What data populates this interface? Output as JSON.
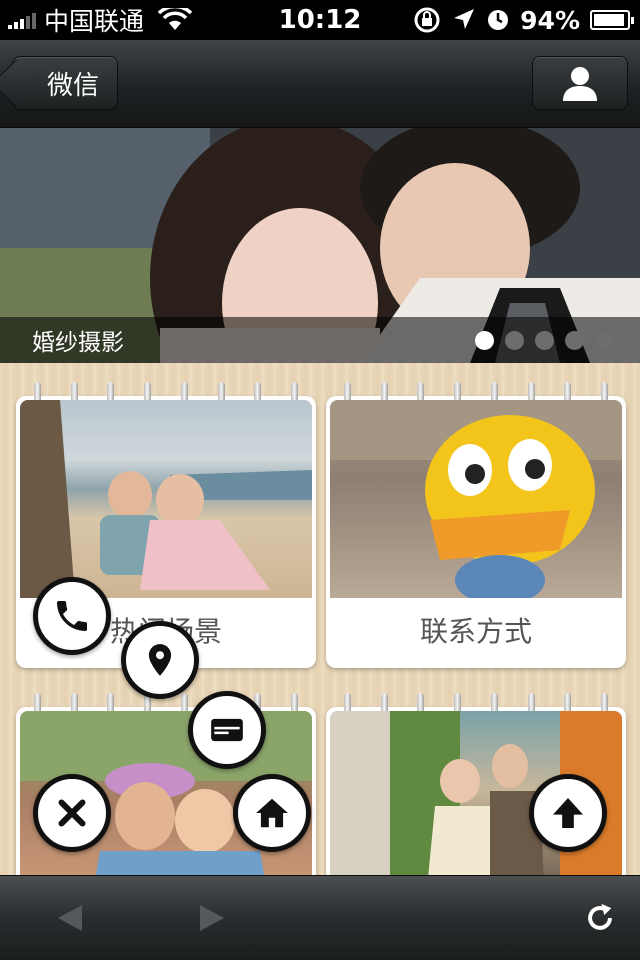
{
  "status_bar": {
    "carrier": "中国联通",
    "time": "10:12",
    "battery_percent_label": "94%",
    "battery_level": 0.94
  },
  "nav": {
    "back_label": "微信",
    "profile_icon": "person-icon"
  },
  "banner": {
    "caption": "婚纱摄影",
    "slide_count": 5,
    "active_slide": 1
  },
  "cards": [
    {
      "label": "热门场景"
    },
    {
      "label": "联系方式"
    },
    {
      "label": ""
    },
    {
      "label": ""
    }
  ],
  "fab_icons": [
    "phone-icon",
    "location-pin-icon",
    "card-icon",
    "close-icon",
    "home-icon",
    "up-arrow-icon"
  ],
  "colors": {
    "nav_dark": "#1f2224",
    "wood": "#e9d6b8",
    "fab_border": "#111111"
  }
}
